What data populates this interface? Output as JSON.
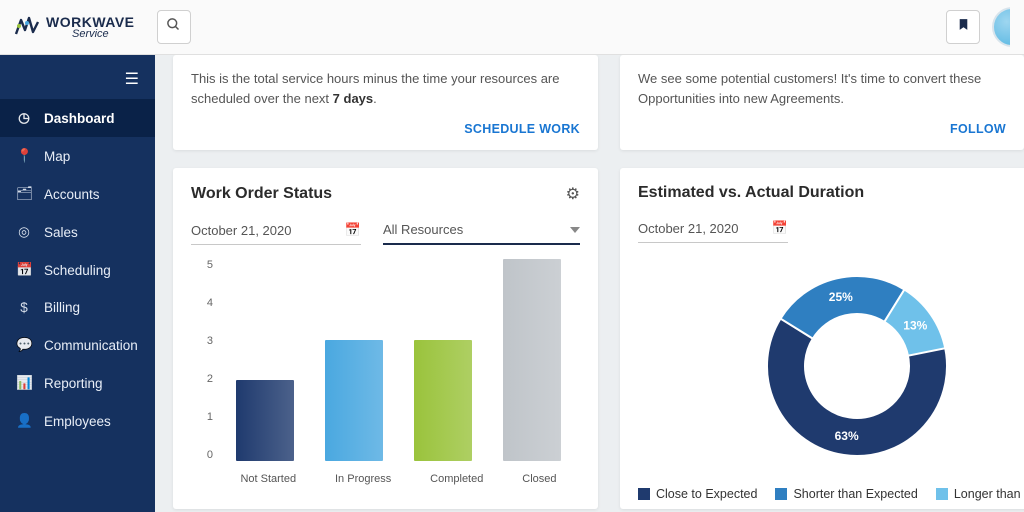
{
  "brand": {
    "word": "WORKWAVE",
    "sub": "Service"
  },
  "sidebar": {
    "items": [
      {
        "label": "Dashboard",
        "icon": "◷"
      },
      {
        "label": "Map",
        "icon": "📍"
      },
      {
        "label": "Accounts",
        "icon": "🗂"
      },
      {
        "label": "Sales",
        "icon": "◎"
      },
      {
        "label": "Scheduling",
        "icon": "📅"
      },
      {
        "label": "Billing",
        "icon": "$"
      },
      {
        "label": "Communication",
        "icon": "💬"
      },
      {
        "label": "Reporting",
        "icon": "📊"
      },
      {
        "label": "Employees",
        "icon": "👤"
      }
    ]
  },
  "topcards": {
    "left": {
      "text_prefix": "This is the total service hours minus the time your resources are scheduled over the next ",
      "bold": "7 days",
      "suffix": ".",
      "action": "SCHEDULE WORK"
    },
    "right": {
      "text": "We see some potential customers! It's time to convert these Opportunities into new Agreements.",
      "action": "FOLLOW"
    }
  },
  "work_order": {
    "title": "Work Order Status",
    "date": "October 21, 2020",
    "resource": "All Resources"
  },
  "duration": {
    "title": "Estimated vs. Actual Duration",
    "date": "October 21, 2020"
  },
  "colors": {
    "bar_not_started": "#1f3a6e",
    "bar_in_progress": "#4aa8e0",
    "bar_completed": "#9ac33c",
    "bar_closed": "#bfc4c9",
    "donut_close": "#1f3a6e",
    "donut_shorter": "#2f7fc1",
    "donut_longer": "#6fc1ea"
  },
  "legend": {
    "close": "Close to Expected",
    "shorter": "Shorter than Expected",
    "longer": "Longer than Expected"
  },
  "chart_data": [
    {
      "type": "bar",
      "title": "Work Order Status",
      "categories": [
        "Not Started",
        "In Progress",
        "Completed",
        "Closed"
      ],
      "values": [
        2,
        3,
        3,
        5
      ],
      "ylim": [
        0,
        5
      ],
      "yticks": [
        0,
        1,
        2,
        3,
        4,
        5
      ],
      "series_colors": [
        "#1f3a6e",
        "#4aa8e0",
        "#9ac33c",
        "#bfc4c9"
      ]
    },
    {
      "type": "pie",
      "title": "Estimated vs. Actual Duration",
      "series": [
        {
          "name": "Close to Expected",
          "value": 63,
          "color": "#1f3a6e"
        },
        {
          "name": "Shorter than Expected",
          "value": 25,
          "color": "#2f7fc1"
        },
        {
          "name": "Longer than Expected",
          "value": 13,
          "color": "#6fc1ea"
        }
      ],
      "labels_suffix": "%"
    }
  ]
}
